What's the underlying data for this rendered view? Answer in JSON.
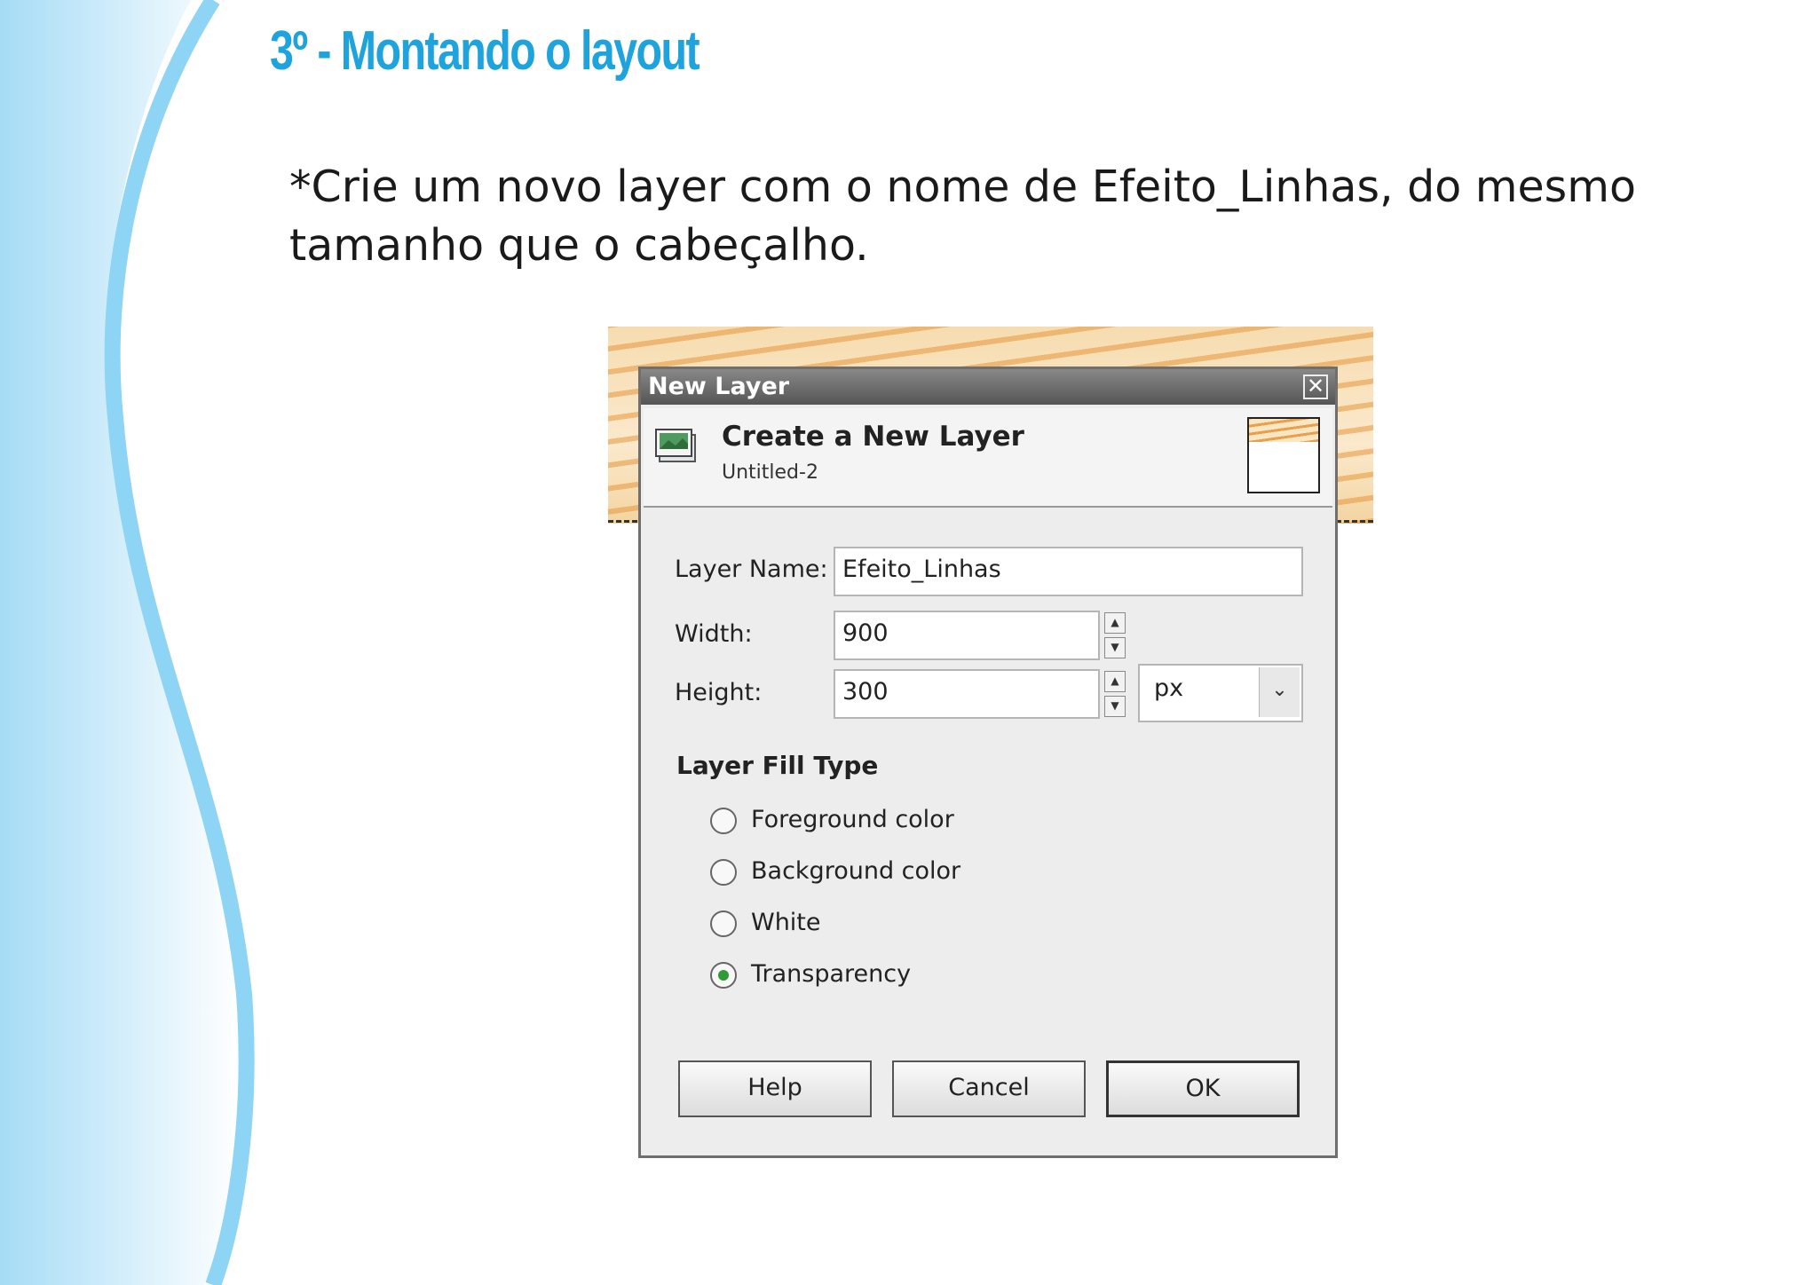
{
  "slide": {
    "title": "3º - Montando o layout",
    "instruction": "*Crie um novo layer com o nome de Efeito_Linhas, do mesmo tamanho que o cabeçalho."
  },
  "dialog": {
    "window_title": "New Layer",
    "close_symbol": "✕",
    "header_title": "Create a New Layer",
    "header_subtitle": "Untitled-2",
    "layer_name_label": "Layer Name:",
    "layer_name_value": "Efeito_Linhas",
    "width_label": "Width:",
    "width_value": "900",
    "height_label": "Height:",
    "height_value": "300",
    "unit_value": "px",
    "fill_type_title": "Layer Fill Type",
    "fill_options": [
      {
        "label": "Foreground color",
        "checked": false
      },
      {
        "label": "Background color",
        "checked": false
      },
      {
        "label": "White",
        "checked": false
      },
      {
        "label": "Transparency",
        "checked": true
      }
    ],
    "buttons": {
      "help": "Help",
      "cancel": "Cancel",
      "ok": "OK"
    }
  },
  "icons": [
    "layer-icon",
    "close-icon",
    "spin-up-icon",
    "spin-down-icon",
    "dropdown-arrow-icon"
  ],
  "colors": {
    "title": "#1ea3dc",
    "wave": "#8ed4f4",
    "radio_checked": "#2e9b35"
  }
}
